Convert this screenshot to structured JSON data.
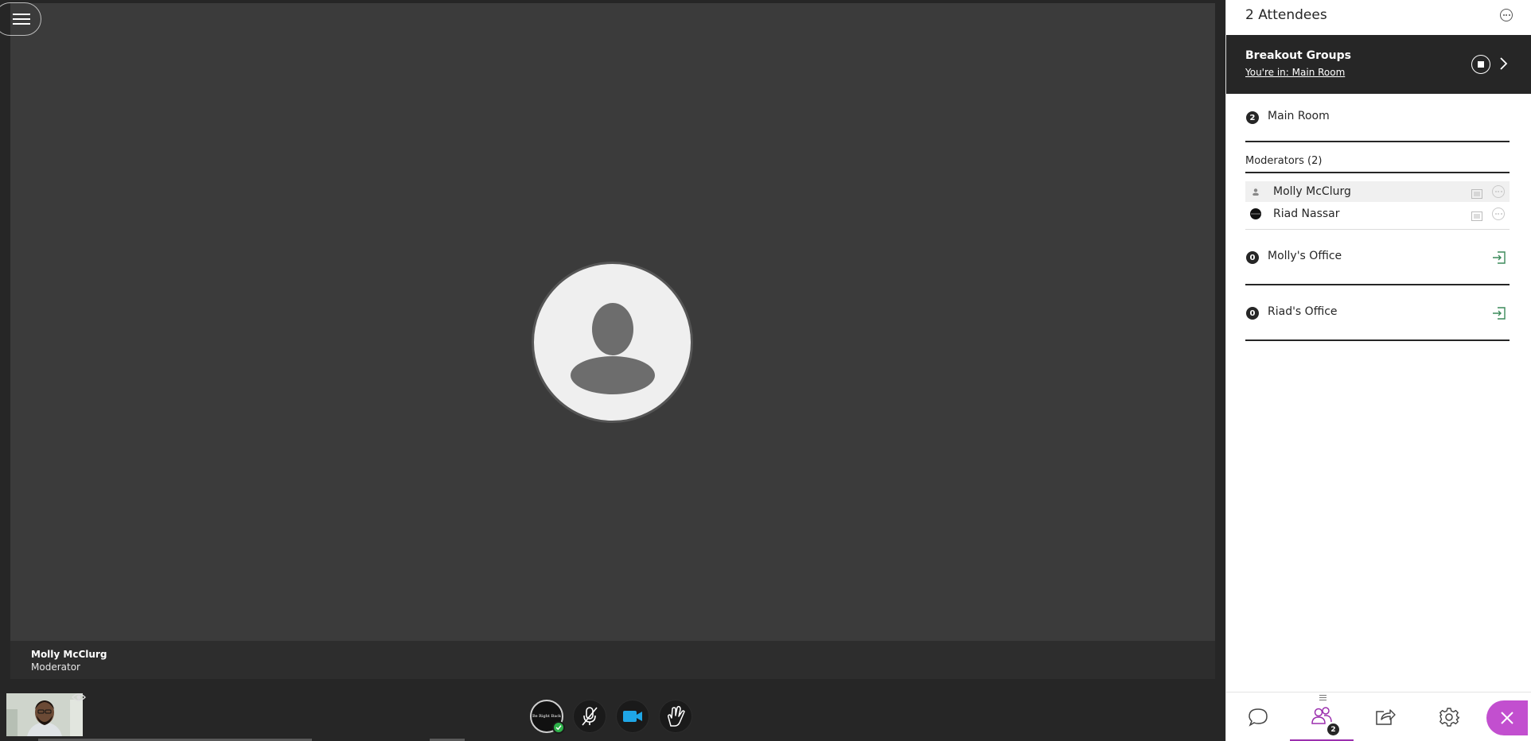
{
  "session": {
    "active_speaker": {
      "name": "Molly McClurg",
      "role": "Moderator"
    },
    "status_button_text": "Be Right Back"
  },
  "panel": {
    "title": "2 Attendees",
    "breakout": {
      "title": "Breakout Groups",
      "subtitle": "You're in: Main Room"
    },
    "groups": [
      {
        "count": "2",
        "name": "Main Room"
      },
      {
        "count": "0",
        "name": "Molly's Office"
      },
      {
        "count": "0",
        "name": "Riad's Office"
      }
    ],
    "moderators_label": "Moderators (2)",
    "attendees": [
      {
        "name": "Molly McClurg"
      },
      {
        "name": "Riad Nassar"
      }
    ],
    "tabs": {
      "attendees_badge": "2"
    }
  },
  "icons": {
    "menu": "hamburger-icon",
    "eye": "eye-icon",
    "mic": "mic-off-icon",
    "camera": "video-camera-icon",
    "hand": "raise-hand-icon",
    "chat": "chat-icon",
    "attendees": "attendees-icon",
    "share": "share-content-icon",
    "settings": "gear-icon",
    "close": "close-icon"
  },
  "colors": {
    "stage_bg": "#3b3b3b",
    "panel_bg": "#ffffff",
    "accent": "#9b2fae",
    "close_btn": "#c24fcf",
    "camera_active": "#1fa6e6",
    "status_check": "#2eb24a",
    "join_icon": "#3b8a5a"
  }
}
